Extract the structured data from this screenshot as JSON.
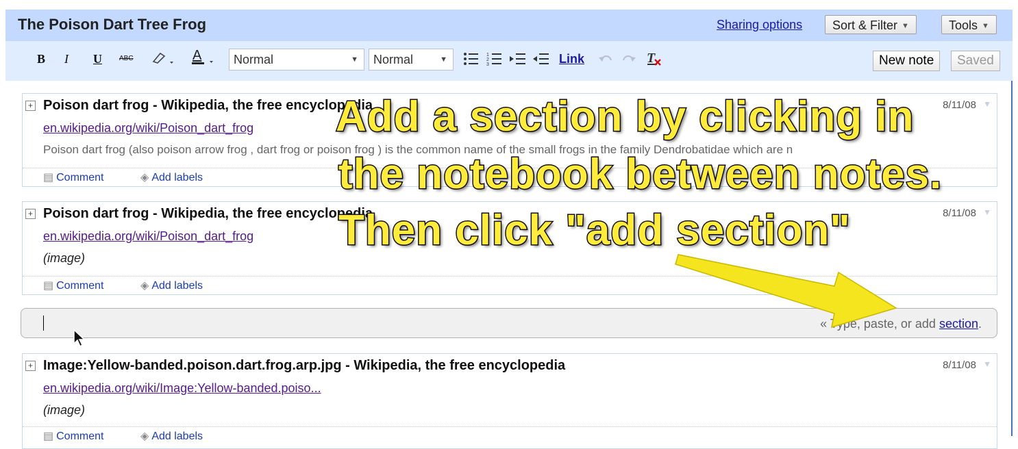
{
  "header": {
    "title": "The Poison Dart Tree Frog",
    "sharing_link": "Sharing options",
    "sort_filter_label": "Sort & Filter",
    "tools_label": "Tools"
  },
  "toolbar": {
    "bold": "B",
    "italic": "I",
    "underline": "U",
    "strike": "ABC",
    "font_select": "Normal",
    "size_select": "Normal",
    "link_label": "Link",
    "new_note": "New note",
    "saved": "Saved"
  },
  "notes": [
    {
      "title": "Poison dart frog - Wikipedia, the free encyclopedia",
      "url": "en.wikipedia.org/wiki/Poison_dart_frog",
      "body": "Poison dart frog (also poison arrow frog , dart frog or poison frog ) is the common name of the small frogs in the family Dendrobatidae which are n",
      "date": "8/11/08",
      "comment": "Comment",
      "labels": "Add labels"
    },
    {
      "title": "Poison dart frog - Wikipedia, the free encyclopedia",
      "url": "en.wikipedia.org/wiki/Poison_dart_frog",
      "body": "(image)",
      "date": "8/11/08",
      "comment": "Comment",
      "labels": "Add labels"
    },
    {
      "title": "Image:Yellow-banded.poison.dart.frog.arp.jpg - Wikipedia, the free encyclopedia",
      "url": "en.wikipedia.org/wiki/Image:Yellow-banded.poiso...",
      "body": "(image)",
      "date": "8/11/08",
      "comment": "Comment",
      "labels": "Add labels"
    }
  ],
  "section_input": {
    "hint_prefix": "« Type, paste, or add ",
    "hint_link": "section",
    "hint_suffix": "."
  },
  "annotation": {
    "line1": "Add a section by clicking in",
    "line2": "the notebook between notes.",
    "line3": "Then click \"add section\""
  },
  "colors": {
    "title_bar": "#c3d9ff",
    "toolbar": "#e0ecff",
    "annotation_text": "#ffeb3b",
    "arrow": "#f5e51e"
  },
  "icons": [
    "strikethrough-icon",
    "highlight-icon",
    "text-color-icon",
    "bullet-list-icon",
    "numbered-list-icon",
    "indent-icon",
    "outdent-icon",
    "undo-icon",
    "redo-icon",
    "clear-formatting-icon",
    "expand-icon",
    "comment-icon",
    "tag-icon",
    "mouse-pointer-icon",
    "arrow-annotation"
  ]
}
